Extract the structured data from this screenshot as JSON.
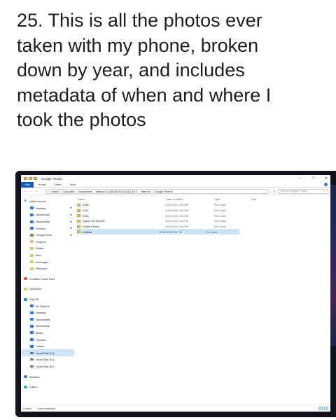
{
  "caption": "25. This is all the photos ever\ntaken with my phone, broken\ndown by year, and includes\nmetadata of when and where I\ntook the photos",
  "window": {
    "title": "Google Photos",
    "controls": {
      "minimize": "—",
      "maximize": "☐",
      "close": "✕"
    }
  },
  "ribbon": {
    "tabs": [
      "File",
      "Home",
      "Share",
      "View"
    ],
    "help": "?"
  },
  "address": {
    "crumbs": [
      "Users",
      "Computer",
      "Downloads",
      "takeout-20180324T145326Z-001",
      "Takeout",
      "Google Photos"
    ],
    "search_placeholder": "Search Google Photos"
  },
  "nav": {
    "quick_access": "Quick access",
    "quick_items": [
      "Desktop",
      "Downloads",
      "Documents",
      "Pictures",
      "Google Drive",
      "Projects",
      "Edited",
      "html",
      "messages",
      "Rescued"
    ],
    "creative_cloud": "Creative Cloud Files",
    "onedrive": "OneDrive",
    "this_pc": "This PC",
    "pc_items": [
      "3D Objects",
      "Desktop",
      "Documents",
      "Downloads",
      "Music",
      "Pictures",
      "Videos",
      "Local Disk (C:)",
      "Local Disk (D:)",
      "Local Disk (E:)"
    ],
    "network": "Network",
    "catch": "Catch!"
  },
  "columns": {
    "name": "Name",
    "date": "Date modified",
    "type": "Type",
    "size": "Size"
  },
  "files": [
    {
      "name": "2016",
      "date": "3/24/2018 3:54 PM",
      "type": "File folder"
    },
    {
      "name": "2017",
      "date": "3/24/2018 3:54 PM",
      "type": "File folder"
    },
    {
      "name": "2018",
      "date": "3/24/2018 3:54 PM",
      "type": "File folder"
    },
    {
      "name": "Dylan Curran DAP",
      "date": "3/24/2018 3:54 PM",
      "type": "File folder"
    },
    {
      "name": "Profile Photos",
      "date": "3/24/2018 3:54 PM",
      "type": "File folder"
    },
    {
      "name": "Untitled",
      "date": "3/24/2018 3:54 PM",
      "type": "File folder"
    }
  ],
  "status": {
    "count": "6 items",
    "selected": "1 item selected"
  }
}
